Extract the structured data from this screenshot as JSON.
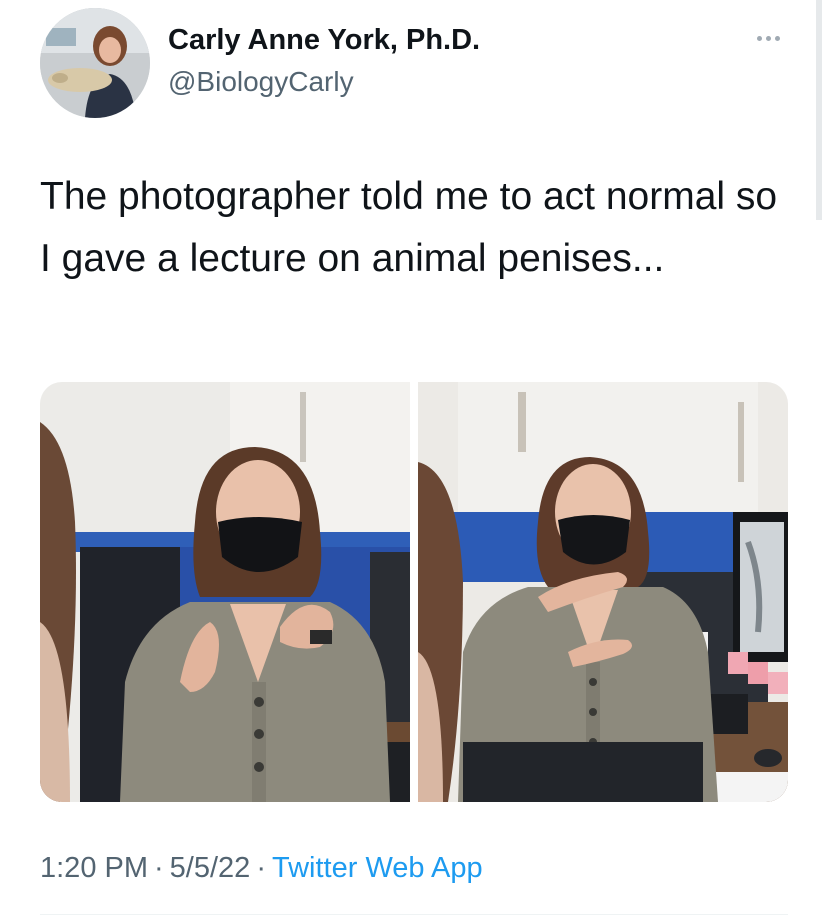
{
  "author": {
    "name": "Carly Anne York, Ph.D.",
    "handle": "@BiologyCarly"
  },
  "tweet": {
    "text": "The photographer told me to act normal so I gave a lecture on animal penises..."
  },
  "media": {
    "photos": [
      {
        "icon": "photo-woman-masked-gesturing"
      },
      {
        "icon": "photo-woman-masked-gesturing-desk"
      }
    ]
  },
  "meta": {
    "time": "1:20 PM",
    "separator": "·",
    "date": "5/5/22",
    "source": "Twitter Web App"
  },
  "colors": {
    "text": "#0f1419",
    "secondary": "#536471",
    "link": "#1d9bf0"
  }
}
